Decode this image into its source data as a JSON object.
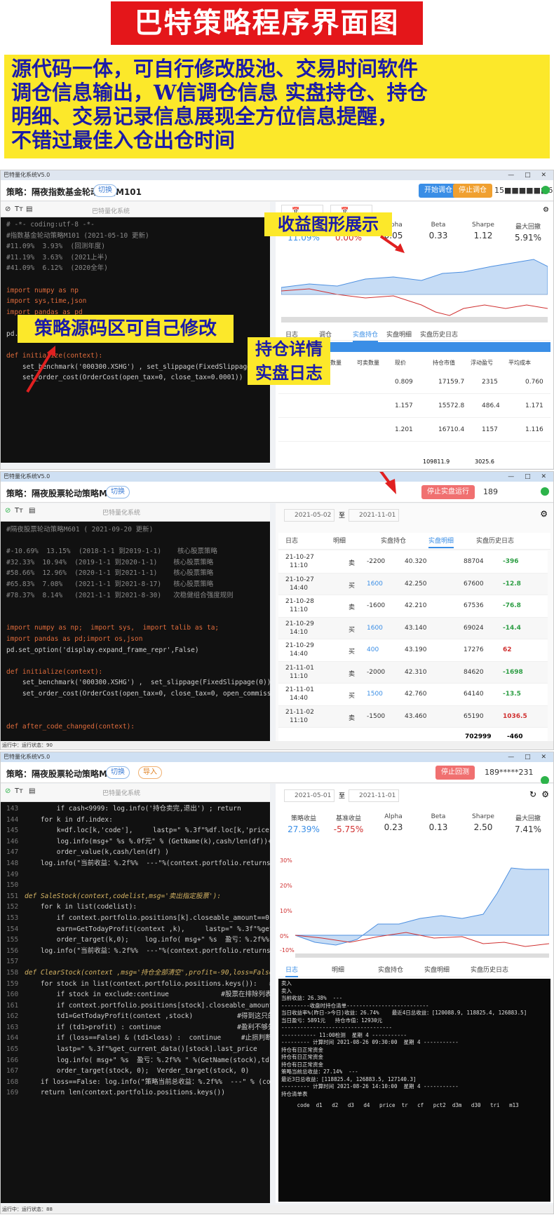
{
  "banner": {
    "title": "巴特策略程序界面图"
  },
  "intro": {
    "line1": "源代码一体，可自行修改股池、交易时间软件",
    "line2": "调仓信息输出，W信调仓信息 实盘持仓、持仓",
    "line3": "明细、交易记录信息展现全方位信息提醒，",
    "line4": "不错过最佳入仓出仓时间"
  },
  "callouts": {
    "chart": "收益图形展示",
    "code": "策略源码区可自己修改",
    "pos1": "持仓详情",
    "pos2": "实盘日志"
  },
  "shot1": {
    "window_title": "巴特量化系统V5.0",
    "strategy": "策略：隔夜指数基金轮动策略M101",
    "switch": "切换",
    "btn1": "开始调仓",
    "btn2": "停止调仓",
    "user": "15■■■■■■6",
    "editor_title": "巴特量化系统",
    "stats": [
      {
        "label": "策略收益",
        "value": "11.09%"
      },
      {
        "label": "基准收益",
        "value": "0.00%"
      },
      {
        "label": "Alpha",
        "value": "0.05"
      },
      {
        "label": "Beta",
        "value": "0.33"
      },
      {
        "label": "Sharpe",
        "value": "1.12"
      },
      {
        "label": "最大回撤",
        "value": "5.91%"
      }
    ],
    "code": [
      "# -*- coding:utf-8 -*-",
      "#指数基金轮动策略M101 (2021-05-10 更新)",
      "#11.09%  3.93%  (回测年度)",
      "#11.19%  3.63%  (2021上半)",
      "#41.09%  6.12%  (2020全年)",
      "",
      "import numpy as np",
      "import sys,time,json",
      "import pandas as pd",
      "",
      "pd.set_option('display.expand_frame_repr',False)",
      "",
      "def initialize(context):",
      "    set_benchmark('000300.XSHG') , set_slippage(FixedSlippage(0))",
      "    set_order_cost(OrderCost(open_tax=0, close_tax=0.0001))"
    ],
    "table_total": "109811.9",
    "table_total2": "3025.6",
    "rows": [
      [
        "0.809",
        "17159.7",
        "2315",
        "0.760"
      ],
      [
        "1.157",
        "15572.8",
        "486.4",
        "1.171"
      ],
      [
        "1.201",
        "16710.4",
        "1157",
        "1.116"
      ]
    ],
    "table_headers": [
      "代码",
      "持仓数量",
      "可卖数量",
      "现价",
      "持仓市值",
      "浮动盈亏",
      "平均成本"
    ],
    "tabs": [
      "日志",
      "调仓",
      "实盘持仓",
      "实盘明细",
      "实盘历史日志"
    ]
  },
  "shot2": {
    "window_title": "巴特量化系统V5.0",
    "strategy": "策略：隔夜股票轮动策略M601",
    "switch": "切换",
    "btn1": "停止实盘运行",
    "user": "189",
    "editor_title": "巴特量化系统",
    "date1": "2021-05-02",
    "date_sep": "至",
    "date2": "2021-11-01",
    "tabs": [
      "日志",
      "明细",
      "实盘持仓",
      "实盘明细",
      "实盘历史日志"
    ],
    "code": [
      "#隔夜股票轮动策略M601 ( 2021-09-20 更新)",
      "",
      "#-10.69%  13.15%  (2018-1-1 到2019-1-1)    核心股票策略",
      "#32.33%  10.94%  (2019-1-1 到2020-1-1)    核心股票策略",
      "#58.66%  12.96%  (2020-1-1 到2021-1-1)    核心股票策略",
      "#65.83%  7.08%   (2021-1-1 到2021-8-17)   核心股票策略",
      "#78.37%  8.14%   (2021-1-1 到2021-8-30)   次稳健组合强度规则",
      "",
      "",
      "import numpy as np;  import sys,  import talib as ta;",
      "import pandas as pd;import os,json",
      "pd.set_option('display.expand_frame_repr',False)",
      "",
      "def initialize(context):",
      "    set_benchmark('000300.XSHG') ,  set_slippage(FixedSlippage(0)) , set_o",
      "    set_order_cost(OrderCost(open_tax=0, close_tax=0, open_commission=0.0002",
      "",
      "",
      "def after_code_changed(context):"
    ],
    "trades": [
      {
        "date": "21-10-27",
        "time": "11:10",
        "side": "卖",
        "qty": "-2200",
        "price": "40.320",
        "amount": "88704",
        "pnl": "-396"
      },
      {
        "date": "21-10-27",
        "time": "14:40",
        "side": "买",
        "qty": "1600",
        "price": "42.250",
        "amount": "67600",
        "pnl": "-12.8"
      },
      {
        "date": "21-10-28",
        "time": "11:10",
        "side": "卖",
        "qty": "-1600",
        "price": "42.210",
        "amount": "67536",
        "pnl": "-76.8"
      },
      {
        "date": "21-10-29",
        "time": "14:10",
        "side": "买",
        "qty": "1600",
        "price": "43.140",
        "amount": "69024",
        "pnl": "-14.4"
      },
      {
        "date": "21-10-29",
        "time": "14:40",
        "side": "买",
        "qty": "400",
        "price": "43.190",
        "amount": "17276",
        "pnl": "62"
      },
      {
        "date": "21-11-01",
        "time": "11:10",
        "side": "卖",
        "qty": "-2000",
        "price": "42.310",
        "amount": "84620",
        "pnl": "-1698"
      },
      {
        "date": "21-11-01",
        "time": "14:40",
        "side": "买",
        "qty": "1500",
        "price": "42.760",
        "amount": "64140",
        "pnl": "-13.5"
      },
      {
        "date": "21-11-02",
        "time": "11:10",
        "side": "卖",
        "qty": "-1500",
        "price": "43.460",
        "amount": "65190",
        "pnl": "1036.5"
      }
    ],
    "total_amount": "702999",
    "total_pnl": "-460",
    "status": "运行中：运行状态：90"
  },
  "shot3": {
    "window_title": "巴特量化系统V5.0",
    "strategy": "策略：隔夜股票轮动策略M601",
    "switch": "切换",
    "import": "导入",
    "btn1": "停止回测",
    "user": "189*****231",
    "editor_title": "巴特量化系统",
    "date1": "2021-05-01",
    "date_sep": "至",
    "date2": "2021-11-01",
    "stats": [
      {
        "label": "策略收益",
        "value": "27.39%"
      },
      {
        "label": "基准收益",
        "value": "-5.75%"
      },
      {
        "label": "Alpha",
        "value": "0.23"
      },
      {
        "label": "Beta",
        "value": "0.13"
      },
      {
        "label": "Sharpe",
        "value": "2.50"
      },
      {
        "label": "最大回撤",
        "value": "7.41%"
      }
    ],
    "tabs": [
      "日志",
      "明细",
      "实盘持仓",
      "实盘明细",
      "实盘历史日志"
    ],
    "code": [
      {
        "n": "143",
        "t": "        if cash<9999: log.info('持仓卖完,退出') ; return"
      },
      {
        "n": "144",
        "t": "    for k in df.index:"
      },
      {
        "n": "145",
        "t": "        k=df.loc[k,'code'],     lastp=\" %.3f\"%df.loc[k,'price']"
      },
      {
        "n": "146",
        "t": "        log.info(msg+\" %s %.0f元\" % (GetName(k),cash/len(df))+lastp )"
      },
      {
        "n": "147",
        "t": "        order_value(k,cash/len(df) )"
      },
      {
        "n": "148",
        "t": "    log.info(\"当前收益：%.2f%%  ---\"%(context.portfolio.returns*100) )"
      },
      {
        "n": "149",
        "t": ""
      },
      {
        "n": "150",
        "t": ""
      },
      {
        "n": "151",
        "t": "def SaleStock(context,codelist,msg='卖出指定股票'):"
      },
      {
        "n": "152",
        "t": "    for k in list(codelist):"
      },
      {
        "n": "153",
        "t": "        if context.portfolio.positions[k].closeable_amount==0:continue"
      },
      {
        "n": "154",
        "t": "        earn=GetTodayProfit(context ,k),     lastp=\" %.3f\"%get_current_dat"
      },
      {
        "n": "155",
        "t": "        order_target(k,0);    log.info( msg+\" %s  盈亏：%.2f%% \" %(GetName"
      },
      {
        "n": "156",
        "t": "    log.info(\"当前收益：%.2f%%  ---\"%(context.portfolio.returns*100) )"
      },
      {
        "n": "157",
        "t": ""
      },
      {
        "n": "158",
        "t": "def ClearStock(context ,msg='持仓全部清空',profit=-90,loss=False,exclude=[]"
      },
      {
        "n": "159",
        "t": "    for stock in list(context.portfolio.positions.keys()):   # 需要加"
      },
      {
        "n": "160",
        "t": "        if stock in exclude:continue             #股票在排除列表中"
      },
      {
        "n": "161",
        "t": "        if context.portfolio.positions[stock].closeable_amount==0: continue"
      },
      {
        "n": "162",
        "t": "        td1=GetTodayProfit(context ,stock)           #得到这只的真实盈利"
      },
      {
        "n": "163",
        "t": "        if (td1>profit) : continue                   #盈利不够先不卖"
      },
      {
        "n": "164",
        "t": "        if (loss==False) & (td1<loss) :  continue     #止损判断"
      },
      {
        "n": "165",
        "t": "        lastp=\" %.3f\"%get_current_data()[stock].last_price     #得到最新价"
      },
      {
        "n": "166",
        "t": "        log.info( msg+\" %s  盈亏：%.2f%% \" %(GetName(stock),td1)+lastp)"
      },
      {
        "n": "167",
        "t": "        order_target(stock, 0);  Verder_target(stock, 0)"
      },
      {
        "n": "168",
        "t": "    if loss==False: log.info(\"策略当前总收益：%.2f%%  ---\" % (context.portfo"
      },
      {
        "n": "169",
        "t": "    return len(context.portfolio.positions.keys())"
      }
    ],
    "log": [
      "卖入",
      "卖入",
      "当前收益：26.38%  ---",
      "---------收盘时持仓清单--------------------------",
      "当日收益率%(昨日->今日)收益：26.74%    最近4日总收益：[120088.9, 118825.4, 126883.5]",
      "当日盈亏：5891元   持仓市值：12930元",
      "-----------------------------------",
      "----------- 11:00检测  星期 4 -----------",
      "--------- 计算时间 2021-08-26 09:30:00  星期 4 -----------",
      "持仓有日正常资金",
      "持仓有日正常资金",
      "持仓有日正常资金",
      "策略当前总收益：27.14%  ---",
      "最近3日总收益：[118825.4, 126883.5, 127140.3]",
      "--------- 计算时间 2021-08-26 14:10:00  星期 4 -----------",
      "持仓清单表"
    ],
    "log_table_header": "     code  d1   d2   d3   d4   price  tr   cf   pct2  d3m   d30   tri   m13",
    "status": "运行中：运行状态：88"
  }
}
